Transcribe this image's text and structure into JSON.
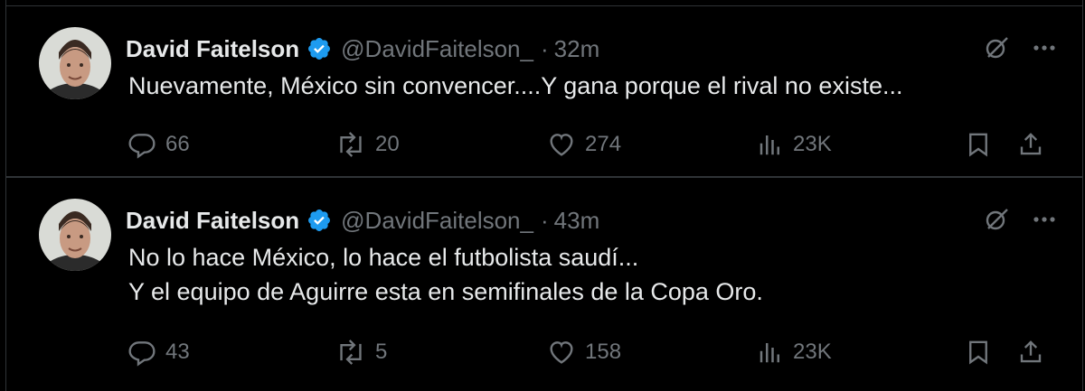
{
  "tweets": [
    {
      "author_name": "David Faitelson",
      "handle": "@DavidFaitelson_",
      "separator": "·",
      "time": "32m",
      "lines": [
        "Nuevamente, México sin convencer....Y gana porque el rival no existe..."
      ],
      "replies": "66",
      "retweets": "20",
      "likes": "274",
      "views": "23K"
    },
    {
      "author_name": "David Faitelson",
      "handle": "@DavidFaitelson_",
      "separator": "·",
      "time": "43m",
      "lines": [
        "No lo hace México, lo hace el futbolista saudí...",
        "Y el equipo de Aguirre esta en semifinales de la Copa Oro."
      ],
      "replies": "43",
      "retweets": "5",
      "likes": "158",
      "views": "23K"
    }
  ],
  "icons": {
    "verified": "verified-badge-icon",
    "grok": "grok-icon",
    "more": "more-dots-icon",
    "reply": "reply-icon",
    "retweet": "retweet-icon",
    "like": "heart-icon",
    "views": "views-icon",
    "bookmark": "bookmark-icon",
    "share": "share-icon"
  },
  "colors": {
    "background": "#000000",
    "text": "#e7e9ea",
    "muted": "#71767b",
    "verified": "#1d9bf0",
    "border": "#2f3336"
  }
}
